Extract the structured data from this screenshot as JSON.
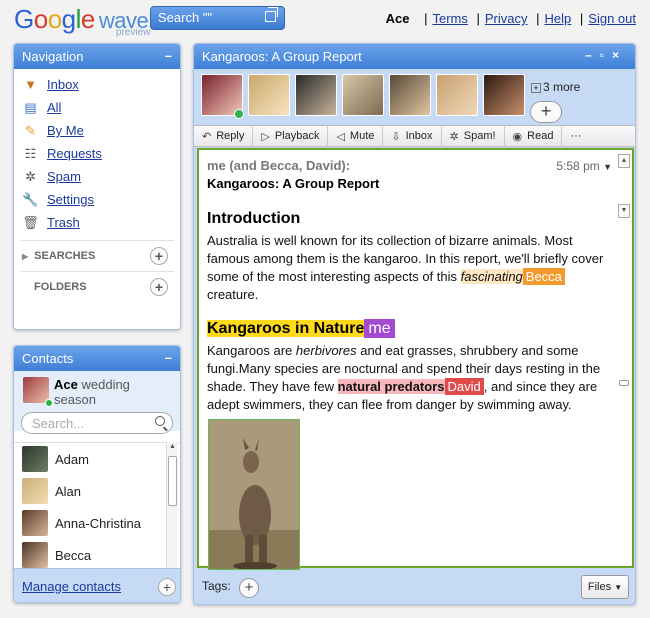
{
  "logo": {
    "google": "Google",
    "product": "wave",
    "sub": "preview"
  },
  "search": {
    "value": "Search \"\""
  },
  "header": {
    "user": "Ace",
    "links": [
      "Terms",
      "Privacy",
      "Help",
      "Sign out"
    ]
  },
  "navigation": {
    "title": "Navigation",
    "items": [
      {
        "label": "Inbox",
        "icon": "inbox-icon"
      },
      {
        "label": "All",
        "icon": "all-icon"
      },
      {
        "label": "By Me",
        "icon": "pencil-icon"
      },
      {
        "label": "Requests",
        "icon": "requests-icon"
      },
      {
        "label": "Spam",
        "icon": "spam-icon"
      },
      {
        "label": "Settings",
        "icon": "wrench-icon"
      },
      {
        "label": "Trash",
        "icon": "trash-icon"
      }
    ],
    "searches_label": "SEARCHES",
    "folders_label": "FOLDERS"
  },
  "contacts": {
    "title": "Contacts",
    "me": {
      "name": "Ace",
      "status": "wedding season"
    },
    "search_placeholder": "Search...",
    "items": [
      "Adam",
      "Alan",
      "Anna-Christina",
      "Becca"
    ],
    "manage_label": "Manage contacts"
  },
  "wave": {
    "title": "Kangaroos: A Group Report",
    "more_label": "3 more",
    "toolbar": [
      "Reply",
      "Playback",
      "Mute",
      "Inbox",
      "Spam!",
      "Read"
    ],
    "blip": {
      "authors": "me (and Becca, David):",
      "title": "Kangaroos: A Group Report",
      "time": "5:58 pm"
    },
    "intro_heading": "Introduction",
    "intro_text_1": "Australia is well known for its collection of bizarre animals. Most famous among them is the kangaroo. In this report, we'll briefly cover some of the most interesting aspects of this ",
    "intro_highlight": "fascinating",
    "intro_tag": "Becca",
    "intro_text_2": " creature.",
    "nature_heading": "Kangaroos in Nature",
    "nature_tag": "me",
    "nature_text_1": "Kangaroos are ",
    "nature_italic": "herbivores",
    "nature_text_2": " and eat grasses, shrubbery and some fungi.Many species are nocturnal and spend their days resting in the shade. They have few ",
    "nature_highlight": "natural predators",
    "nature_tag2": "David",
    "nature_text_3": ", and since they are adept swimmers, they can flee from danger by swimming away.",
    "tags_label": "Tags:",
    "files_label": "Files"
  }
}
